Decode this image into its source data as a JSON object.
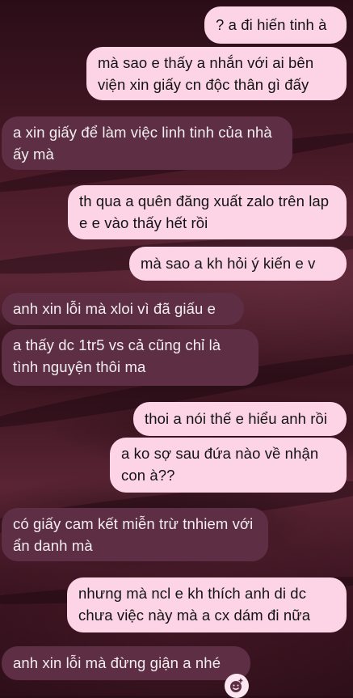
{
  "messages": [
    {
      "sender": "me",
      "text": "? a đi hiến tinh à"
    },
    {
      "sender": "me",
      "text": "mà sao e thấy a nhắn với ai bên viện xin giấy cn độc thân gì đấy"
    },
    {
      "sender": "them",
      "text": "a xin giấy để làm việc linh tinh của nhà ấy mà"
    },
    {
      "sender": "me",
      "text": "th qua a quên đăng xuất zalo trên lap e e vào thấy hết rồi"
    },
    {
      "sender": "me",
      "text": "mà sao a kh hỏi ý kiến e v"
    },
    {
      "sender": "them",
      "text": "anh xin lỗi mà xloi vì đã giấu e"
    },
    {
      "sender": "them",
      "text": "a thấy dc 1tr5 vs cả cũng chỉ là tình nguyện thôi ma"
    },
    {
      "sender": "me",
      "text": "thoi a nói thế e hiểu anh rồi"
    },
    {
      "sender": "me",
      "text": "a ko sợ sau đứa nào về nhận con à??"
    },
    {
      "sender": "them",
      "text": "có giấy cam kết miễn trừ tnhiem với ẩn danh mà"
    },
    {
      "sender": "me",
      "text": "nhưng mà ncl e kh thích anh di dc chưa việc này mà a cx dám đi nữa"
    },
    {
      "sender": "them",
      "text": "anh xin lỗi mà đừng giận a nhé"
    }
  ],
  "reaction_icon": "add-reaction-icon",
  "colors": {
    "sent_bubble": "#fcd4e6",
    "received_bubble": "#5e2f44",
    "background": "#3b1420"
  }
}
